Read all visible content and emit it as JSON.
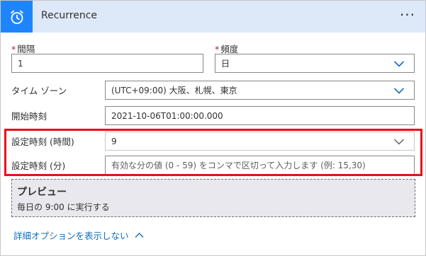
{
  "header": {
    "title": "Recurrence",
    "more_label": "···",
    "icon": "alarm-clock-icon",
    "accent_color": "#1f85ff",
    "background_color": "#dde9f9"
  },
  "interval": {
    "label": "間隔",
    "required_mark": "*",
    "value": "1"
  },
  "frequency": {
    "label": "頻度",
    "required_mark": "*",
    "value": "日"
  },
  "timezone": {
    "label": "タイム ゾーン",
    "value": "(UTC+09:00) 大阪、札幌、東京"
  },
  "start_time": {
    "label": "開始時刻",
    "value": "2021-10-06T01:00:00.000"
  },
  "at_hours": {
    "label": "設定時刻 (時間)",
    "value": "9"
  },
  "at_minutes": {
    "label": "設定時刻 (分)",
    "placeholder": "有効な分の値 (0 - 59) をコンマで区切って入力します (例: 15,30)"
  },
  "highlight_color": "#e8101a",
  "preview": {
    "title": "プレビュー",
    "text": "毎日の 9:00 に実行する"
  },
  "advanced": {
    "label": "詳細オプションを表示しない",
    "icon": "chevron-up-icon",
    "color": "#0f6cbd"
  }
}
